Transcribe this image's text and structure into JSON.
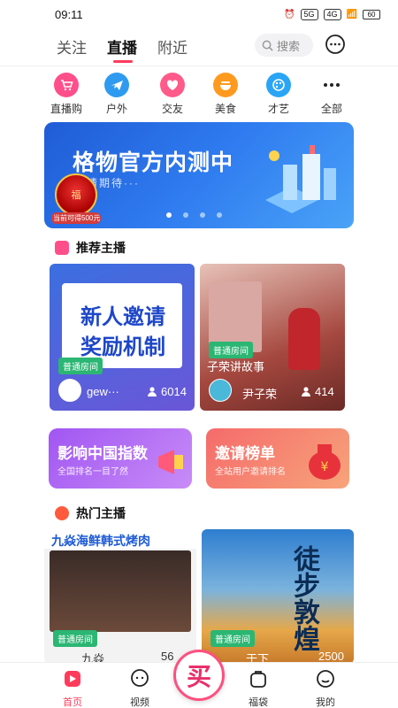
{
  "status": {
    "time": "09:11",
    "network": "5G",
    "signal": "4G",
    "battery": "60"
  },
  "top_nav": {
    "tabs": [
      {
        "label": "关注"
      },
      {
        "label": "直播"
      },
      {
        "label": "附近"
      }
    ],
    "active_tab": "直播",
    "search_placeholder": "搜索"
  },
  "categories": [
    {
      "label": "直播购",
      "icon": "cart-icon",
      "color": "#ff4f8b"
    },
    {
      "label": "户外",
      "icon": "plane-icon",
      "color": "#2e9bf0"
    },
    {
      "label": "交友",
      "icon": "heart-icon",
      "color": "#ff5a8a"
    },
    {
      "label": "美食",
      "icon": "food-icon",
      "color": "#ff9a1f"
    },
    {
      "label": "才艺",
      "icon": "palette-icon",
      "color": "#2aa5f5"
    },
    {
      "label": "全部",
      "icon": "more-icon",
      "color": "#222222"
    }
  ],
  "banner": {
    "title": "格物官方内测中",
    "subtitle": "请期待···",
    "badge_label": "当前可得500元",
    "badge_text": "福",
    "active_dot": 0,
    "dots": 4
  },
  "recommended": {
    "title": "推荐主播",
    "cards": [
      {
        "poster_text": "新人邀请 奖励机制",
        "room_tag": "普通房间",
        "name": "gew···",
        "count": "6014"
      },
      {
        "poster_text": "子荣讲故事",
        "room_tag": "普通房间",
        "name": "尹子荣",
        "count": "414"
      }
    ]
  },
  "promos": [
    {
      "title": "影响中国指数",
      "subtitle": "全国排名一目了然"
    },
    {
      "title": "邀请榜单",
      "subtitle": "全站用户邀请排名"
    }
  ],
  "hot": {
    "title": "热门主播",
    "cards": [
      {
        "poster_text": "九焱海鲜韩式烤肉",
        "room_tag": "普通房间",
        "name": "九焱",
        "count": "56"
      },
      {
        "poster_text": "徒步敦煌",
        "room_tag": "普通房间",
        "name": "于下",
        "count": "2500"
      }
    ]
  },
  "bottom_nav": {
    "items": [
      {
        "label": "首页"
      },
      {
        "label": "视频"
      },
      {
        "label": "福袋"
      },
      {
        "label": "我的"
      }
    ],
    "center_label": "买"
  },
  "colors": {
    "accent": "#ff3b5c",
    "room_tag": "#2bb673"
  }
}
